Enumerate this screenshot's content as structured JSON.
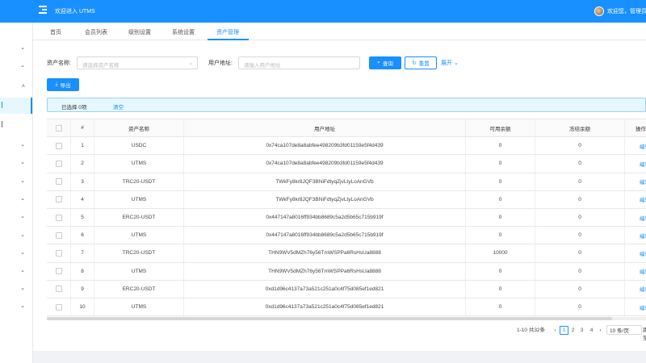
{
  "header": {
    "welcome": "欢迎进入 UTMS",
    "greeting": "欢迎您，管理员"
  },
  "sidebar": {
    "items": [
      {
        "icon": "chevron-down-icon",
        "active": false
      },
      {
        "icon": "chevron-down-icon",
        "active": false
      },
      {
        "icon": "chevron-up-icon",
        "active": false
      },
      {
        "icon": "menu-item-icon",
        "active": true
      },
      {
        "icon": "menu-item-icon",
        "active": false
      },
      {
        "icon": "chevron-down-icon",
        "active": false
      },
      {
        "icon": "chevron-down-icon",
        "active": false
      },
      {
        "icon": "chevron-down-icon",
        "active": false
      },
      {
        "icon": "chevron-down-icon",
        "active": false
      },
      {
        "icon": "chevron-down-icon",
        "active": false
      },
      {
        "icon": "chevron-down-icon",
        "active": false
      },
      {
        "icon": "chevron-down-icon",
        "active": false
      },
      {
        "icon": "chevron-down-icon",
        "active": false
      },
      {
        "icon": "chevron-down-icon",
        "active": false
      },
      {
        "icon": "chevron-down-icon",
        "active": false
      }
    ]
  },
  "tabs": [
    {
      "label": "首页"
    },
    {
      "label": "会员列表"
    },
    {
      "label": "级别设置"
    },
    {
      "label": "系统设置"
    },
    {
      "label": "资产管理",
      "active": true
    }
  ],
  "filters": {
    "asset_label": "资产名称:",
    "asset_placeholder": "请选择资产名称",
    "address_label": "用户地址:",
    "address_placeholder": "请输入用户地址",
    "search_label": "查询",
    "reset_label": "重置",
    "expand_label": "展开"
  },
  "toolbar": {
    "export_label": "导出"
  },
  "alert": {
    "selected_text": "已选择 0项",
    "clear_label": "清空"
  },
  "table": {
    "columns": [
      "#",
      "资产名称",
      "用户地址",
      "可用余额",
      "冻结余额",
      "操作"
    ],
    "rows": [
      {
        "no": "1",
        "asset": "USDC",
        "address": "0x74ca107de8a8abfee498209b3fd01159e5f4d439",
        "available": "0",
        "frozen": "0"
      },
      {
        "no": "2",
        "asset": "UTMS",
        "address": "0x74ca107de8a8abfee498209b3fd01159e5f4d439",
        "available": "0",
        "frozen": "0"
      },
      {
        "no": "3",
        "asset": "TRC20-USDT",
        "address": "TWkFy8kr8JQF3BNiFdtyqZjvLtyLoAnGVb",
        "available": "0",
        "frozen": "0"
      },
      {
        "no": "4",
        "asset": "UTMS",
        "address": "TWkFy8kr8JQF3BNiFdtyqZjvLtyLoAnGVb",
        "available": "0",
        "frozen": "0"
      },
      {
        "no": "5",
        "asset": "ERC20-USDT",
        "address": "0x447147a8016ff934bb8689c5a2d5b65c715b919f",
        "available": "0",
        "frozen": "0"
      },
      {
        "no": "6",
        "asset": "UTMS",
        "address": "0x447147a8016ff934bb8689c5a2d5b65c715b919f",
        "available": "0",
        "frozen": "0"
      },
      {
        "no": "7",
        "asset": "TRC20-USDT",
        "address": "THN9WV5dMZh76y56TmWSPPa6RsHsUa8888",
        "available": "10000",
        "frozen": "0"
      },
      {
        "no": "8",
        "asset": "UTMS",
        "address": "THN9WV5dMZh76y56TmWSPPa6RsHsUa8888",
        "available": "0",
        "frozen": "0"
      },
      {
        "no": "9",
        "asset": "ERC20-USDT",
        "address": "0xd1d96c4137a73a521c251a0c4f75d085ef1ed821",
        "available": "0",
        "frozen": "0"
      },
      {
        "no": "10",
        "asset": "UTMS",
        "address": "0xd1d96c4137a73a521c251a0c4f75d085ef1ed821",
        "available": "0",
        "frozen": "0"
      }
    ],
    "action_label": "编辑"
  },
  "pagination": {
    "summary": "1-10 共32条",
    "pages": [
      "1",
      "2",
      "3",
      "4"
    ],
    "current": "1",
    "page_size": "10 条/页",
    "goto_label": "跳至"
  },
  "colors": {
    "primary": "#1890ff",
    "header": "#1890ff"
  }
}
